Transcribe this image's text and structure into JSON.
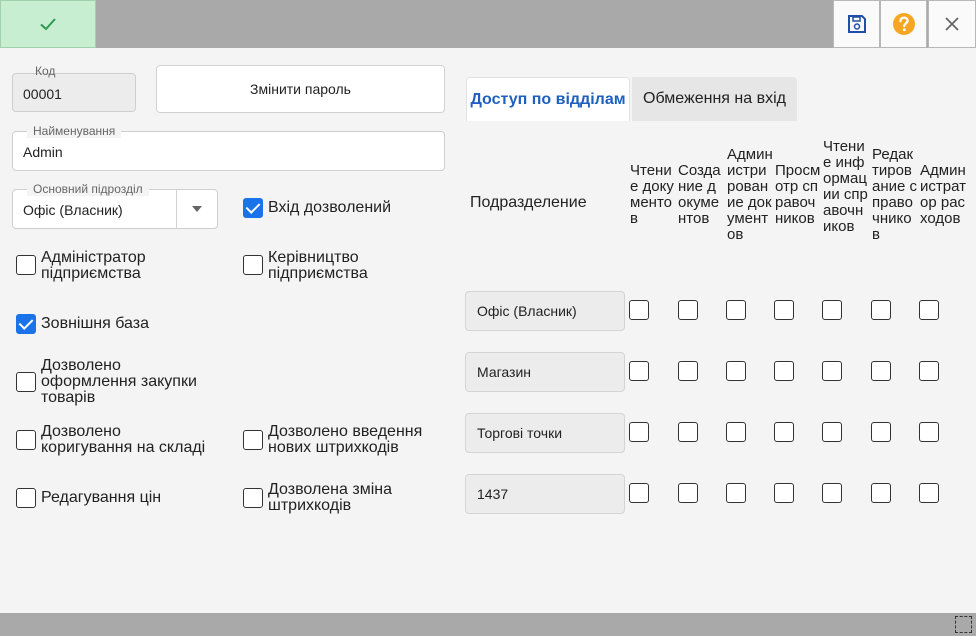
{
  "toolbar": {
    "ok_icon": "check-icon",
    "save_icon": "save-icon",
    "help_icon": "help-icon",
    "close_icon": "close-icon",
    "help_color": "#f5a623",
    "ok_color": "#c8eed2"
  },
  "form": {
    "code_label": "Код",
    "code_value": "00001",
    "change_password_label": "Змінити пароль",
    "name_label": "Найменування",
    "name_value": "Admin",
    "dept_label": "Основний підрозділ",
    "dept_value": "Офіс (Власник)"
  },
  "checkboxes": [
    {
      "line1": "Вхід дозволений",
      "line2": "",
      "checked": true
    },
    {
      "line1": "Адміністратор",
      "line2": "підприємства",
      "checked": false
    },
    {
      "line1": "Керівництво",
      "line2": "підприємства",
      "checked": false
    },
    {
      "line1": "Зовнішня база",
      "line2": "",
      "checked": true
    },
    {
      "line1": "Дозволено",
      "line2": "оформлення закупки",
      "line3": "товарів",
      "checked": false
    },
    {
      "line1": "Дозволено",
      "line2": "коригування на складі",
      "checked": false
    },
    {
      "line1": "Дозволено введення",
      "line2": "нових штрихкодів",
      "checked": false
    },
    {
      "line1": "Редагування цін",
      "line2": "",
      "checked": false
    },
    {
      "line1": "Дозволена зміна",
      "line2": "штрихкодів",
      "checked": false
    }
  ],
  "tabs": [
    {
      "label": "Доступ по відділам",
      "active": true
    },
    {
      "label": "Обмеження на вхід",
      "active": false
    }
  ],
  "access_table": {
    "first_header": "Подразделение",
    "columns": [
      "Чтение документов",
      "Создание документов",
      "Администрирование документов",
      "Просмотр справочников",
      "Чтение информации справочников",
      "Редактирование справочников",
      "Администратор расходов"
    ],
    "rows": [
      {
        "dept": "Офіс (Власник)"
      },
      {
        "dept": "Магазин"
      },
      {
        "dept": "Торгові точки"
      },
      {
        "dept": "1437"
      }
    ]
  }
}
